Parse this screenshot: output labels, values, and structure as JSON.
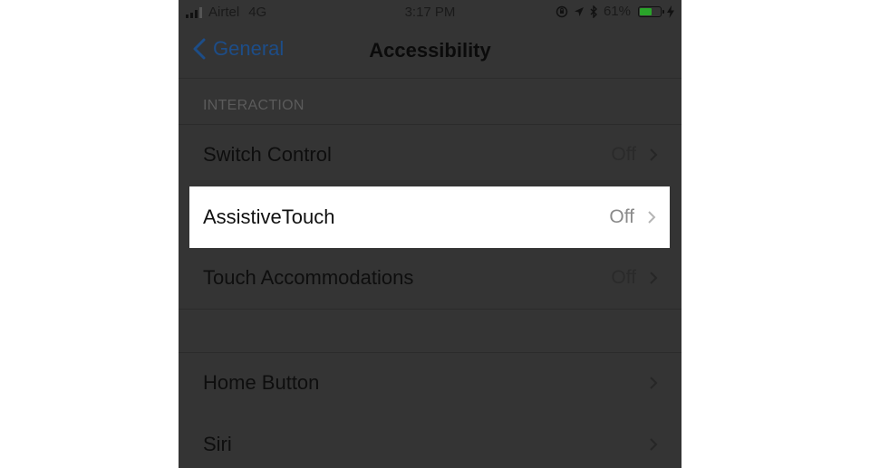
{
  "status_bar": {
    "carrier": "Airtel",
    "network": "4G",
    "time": "3:17 PM",
    "battery_percent": "61%",
    "battery_level": 0.61,
    "icons": [
      "signal-icon",
      "orientation-lock-icon",
      "location-icon",
      "bluetooth-icon",
      "battery-icon",
      "charging-icon"
    ]
  },
  "nav": {
    "back_label": "General",
    "title": "Accessibility"
  },
  "section": {
    "header": "INTERACTION"
  },
  "rows": [
    {
      "label": "Switch Control",
      "value": "Off"
    },
    {
      "label": "AssistiveTouch",
      "value": "Off"
    },
    {
      "label": "Touch Accommodations",
      "value": "Off"
    },
    {
      "label": "Home Button",
      "value": ""
    },
    {
      "label": "Siri",
      "value": ""
    }
  ],
  "colors": {
    "dim_background": "#343434",
    "highlight": "#ffffff",
    "link": "#1d4d88",
    "battery_green": "#2aa52a"
  }
}
